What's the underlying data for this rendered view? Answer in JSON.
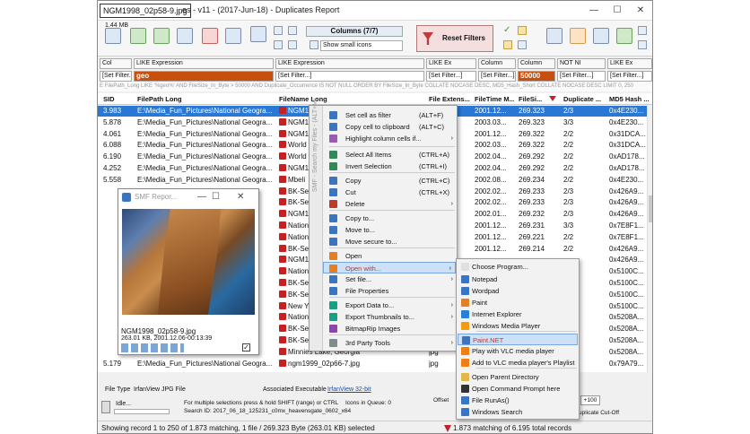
{
  "window": {
    "file_tab": "NGM1998_02p58-9.jpg",
    "title": "es - v11 - (2017-Jun-18) - Duplicates Report",
    "minimize": "—",
    "maximize": "☐",
    "close": "✕"
  },
  "toolbar": {
    "size_label": "1.44 MB",
    "columns_btn": "Columns (7/7)",
    "show_icons": "Show small icons",
    "reset_filters": "Reset Filters"
  },
  "filters": {
    "row1": [
      "Col",
      "LIKE Expression",
      "LIKE Expression",
      "LIKE Ex",
      "Column",
      "Column",
      "NOT NI",
      "LIKE Ex"
    ],
    "row2": [
      "[Set Filter...]",
      "geo",
      "[Set Filter...]",
      "[Set Filter...]",
      "[Set Filter...]",
      "50000",
      "[Set Filter...]",
      "[Set Filter...]"
    ],
    "sql": "E FilePath_Long LIKE '%geo%' AND FileSize_In_Byte > 50000 AND Duplicate_Occurrence IS NOT NULL ORDER BY FileSize_In_Byte COLLATE NOCASE DESC, MD5_Hash_Short COLLATE NOCASE DESC LIMIT 0, 250"
  },
  "grid": {
    "headers": [
      "SID",
      "FilePath Long",
      "FileName Long",
      "File Extens...",
      "FileTime M...",
      "FileSi...",
      "Duplicate ...",
      "MD5 Hash ..."
    ],
    "rows": [
      [
        "3.983",
        "E:\\Media_Fun_Pictures\\National Geogra...",
        "NGM1",
        "",
        "2001.12...",
        "269.323",
        "2/3",
        "0x4E230..."
      ],
      [
        "5.878",
        "E:\\Media_Fun_Pictures\\National Geogra...",
        "NGM1",
        "",
        "2003.03...",
        "269.323",
        "3/3",
        "0x4E230..."
      ],
      [
        "4.061",
        "E:\\Media_Fun_Pictures\\National Geogra...",
        "NGM1",
        "",
        "2001.12...",
        "269.322",
        "2/2",
        "0x31DCA..."
      ],
      [
        "6.088",
        "E:\\Media_Fun_Pictures\\National Geogra...",
        "World",
        "",
        "2002.03...",
        "269.322",
        "2/2",
        "0x31DCA..."
      ],
      [
        "6.190",
        "E:\\Media_Fun_Pictures\\National Geogra...",
        "World",
        "",
        "2002.04...",
        "269.292",
        "2/2",
        "0xAD178..."
      ],
      [
        "4.252",
        "E:\\Media_Fun_Pictures\\National Geogra...",
        "NGM1",
        "",
        "2002.04...",
        "269.292",
        "2/2",
        "0xAD178..."
      ],
      [
        "5.558",
        "E:\\Media_Fun_Pictures\\National Geogra...",
        "Mbeli",
        "",
        "2002.08...",
        "269.234",
        "2/2",
        "0x4E230..."
      ],
      [
        "",
        "",
        "BK-Se",
        "",
        "2002.02...",
        "269.233",
        "2/3",
        "0x426A9..."
      ],
      [
        "",
        "",
        "BK-Se",
        "",
        "2002.02...",
        "269.233",
        "2/3",
        "0x426A9..."
      ],
      [
        "",
        "",
        "NGM1",
        "",
        "2002.01...",
        "269.232",
        "2/3",
        "0x426A9..."
      ],
      [
        "",
        "",
        "Nation",
        "",
        "2001.12...",
        "269.231",
        "3/3",
        "0x7E8F1..."
      ],
      [
        "",
        "",
        "Nation",
        "",
        "2001.12...",
        "269.221",
        "2/2",
        "0x7E8F1..."
      ],
      [
        "",
        "",
        "BK-Se",
        "",
        "2001.12...",
        "269.214",
        "2/2",
        "0x426A9..."
      ],
      [
        "",
        "",
        "NGM1",
        "",
        "",
        "",
        "",
        "0x426A9..."
      ],
      [
        "",
        "",
        "Nation",
        "",
        "",
        "",
        "",
        "0x5100C..."
      ],
      [
        "",
        "",
        "BK-Se",
        "",
        "",
        "",
        "",
        "0x5100C..."
      ],
      [
        "",
        "",
        "BK-Se",
        "",
        "",
        "",
        "",
        "0x5100C..."
      ],
      [
        "",
        "",
        "New Y",
        "",
        "",
        "",
        "",
        "0x5100C..."
      ],
      [
        "",
        "",
        "Nation",
        "",
        "",
        "",
        "",
        "0x5208A..."
      ],
      [
        "",
        "",
        "BK-Se",
        "",
        "",
        "",
        "",
        "0x5208A..."
      ],
      [
        "",
        "",
        "BK-Se",
        "",
        "",
        "",
        "",
        "0x5208A..."
      ],
      [
        "",
        "",
        "Minnies Lake, Georgia",
        "jpg",
        "",
        "",
        "",
        "0x5208A..."
      ],
      [
        "5.179",
        "E:\\Media_Fun_Pictures\\National Geogra...",
        "ngm1999_02p66-7.jpg",
        "jpg",
        "",
        "",
        "",
        "0x79A79..."
      ]
    ]
  },
  "preview": {
    "title": "SMF Repor...",
    "caption": "NGM1998_02p58-9.jpg",
    "info": "263.01 KB, 2001.12.06-00:13:39"
  },
  "context_menu": {
    "side_label": "SMF - Search my Files - (ALT+M)",
    "items": [
      {
        "label": "Set cell as filter",
        "shortcut": "(ALT+F)",
        "arrow": ""
      },
      {
        "label": "Copy cell to clipboard",
        "shortcut": "(ALT+C)",
        "arrow": ""
      },
      {
        "label": "Highlight column cells if...",
        "shortcut": "",
        "arrow": "›"
      },
      {
        "label": "Select All Items",
        "shortcut": "(CTRL+A)",
        "arrow": ""
      },
      {
        "label": "Invert Selection",
        "shortcut": "(CTRL+I)",
        "arrow": ""
      },
      {
        "label": "Copy",
        "shortcut": "(CTRL+C)",
        "arrow": ""
      },
      {
        "label": "Cut",
        "shortcut": "(CTRL+X)",
        "arrow": ""
      },
      {
        "label": "Delete",
        "shortcut": "",
        "arrow": "›"
      },
      {
        "label": "Copy to...",
        "shortcut": "",
        "arrow": ""
      },
      {
        "label": "Move to...",
        "shortcut": "",
        "arrow": ""
      },
      {
        "label": "Move secure to...",
        "shortcut": "",
        "arrow": ""
      },
      {
        "label": "Open",
        "shortcut": "",
        "arrow": ""
      },
      {
        "label": "Open with...",
        "shortcut": "",
        "arrow": "›"
      },
      {
        "label": "Set file...",
        "shortcut": "",
        "arrow": "›"
      },
      {
        "label": "File Properties",
        "shortcut": "",
        "arrow": ""
      },
      {
        "label": "Export Data to...",
        "shortcut": "",
        "arrow": "›"
      },
      {
        "label": "Export Thumbnails to...",
        "shortcut": "",
        "arrow": "›"
      },
      {
        "label": "BitmapRip Images",
        "shortcut": "",
        "arrow": ""
      },
      {
        "label": "3rd Party Tools",
        "shortcut": "",
        "arrow": "›"
      }
    ]
  },
  "submenu": {
    "items": [
      "Choose Program...",
      "Notepad",
      "Wordpad",
      "Paint",
      "Internet Explorer",
      "Windows Media Player",
      "Paint.NET",
      "Play with VLC media player",
      "Add to VLC media player's Playlist",
      "Open Parent Directory",
      "Open Command Prompt here",
      "File RunAs()",
      "Windows Search"
    ]
  },
  "bottom": {
    "file_type_label": "File Type",
    "file_type_value": "IrfanView JPG File",
    "assoc_label": "Associated Executable",
    "assoc_value": "IrfanView 32-bit",
    "idle": "Idle...",
    "hint": "For multiple selections press & hold SHIFT (range) or CTRL",
    "search_id": "Search ID:  2017_06_18_125231_c0mx_heavensgate_0602_x64",
    "icons_queue": "Icons in Queue:  0",
    "offset": "Offset",
    "plus100": "+100",
    "dup_cutoff": "uplicate Cut-Off"
  },
  "status": {
    "left": "Showing record 1 to 250 of 1.873 matching, 1 file / 269.323 Byte (263.01 KB) selected",
    "right": "1.873 matching of 6.195 total records"
  }
}
